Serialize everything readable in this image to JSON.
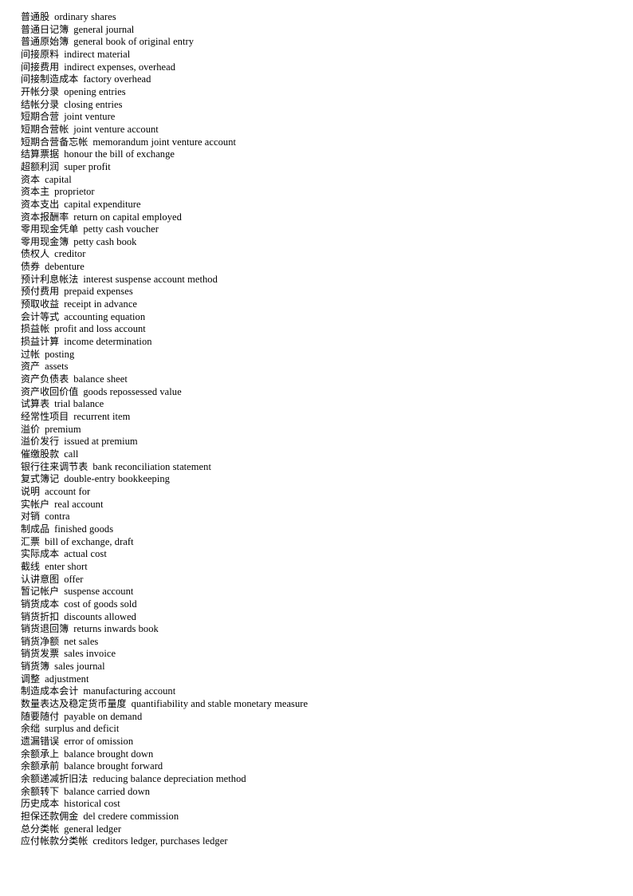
{
  "document": {
    "type": "glossary",
    "language_pair": "Chinese-English",
    "subject": "accounting terminology",
    "entries": [
      {
        "term": "普通股",
        "definition": "ordinary shares"
      },
      {
        "term": "普通日记簿",
        "definition": "general journal"
      },
      {
        "term": "普通原始簿",
        "definition": "general book of original entry"
      },
      {
        "term": "间接原料",
        "definition": "indirect material"
      },
      {
        "term": "间接费用",
        "definition": "indirect expenses, overhead"
      },
      {
        "term": "间接制造成本",
        "definition": "factory overhead"
      },
      {
        "term": "开帐分录",
        "definition": "opening entries"
      },
      {
        "term": "结帐分录",
        "definition": "closing entries"
      },
      {
        "term": "短期合营",
        "definition": "joint venture"
      },
      {
        "term": "短期合营帐",
        "definition": "joint venture account"
      },
      {
        "term": "短期合营备忘帐",
        "definition": "memorandum joint venture account"
      },
      {
        "term": "结算票据",
        "definition": "honour the bill of exchange"
      },
      {
        "term": "超额利润",
        "definition": "super profit"
      },
      {
        "term": "资本",
        "definition": "capital"
      },
      {
        "term": "资本主",
        "definition": "proprietor"
      },
      {
        "term": "资本支出",
        "definition": "capital expenditure"
      },
      {
        "term": "资本报酬率",
        "definition": "return on capital employed"
      },
      {
        "term": "零用现金凭单",
        "definition": "petty cash voucher"
      },
      {
        "term": "零用现金簿",
        "definition": "petty cash book"
      },
      {
        "term": "债权人",
        "definition": "creditor"
      },
      {
        "term": "债券",
        "definition": "debenture"
      },
      {
        "term": "预计利息帐法",
        "definition": "interest suspense account method"
      },
      {
        "term": "预付费用",
        "definition": "prepaid expenses"
      },
      {
        "term": "预取收益",
        "definition": "receipt in advance"
      },
      {
        "term": "会计等式",
        "definition": "accounting equation"
      },
      {
        "term": "损益帐",
        "definition": "profit and loss account"
      },
      {
        "term": "损益计算",
        "definition": "income determination"
      },
      {
        "term": "过帐",
        "definition": "posting"
      },
      {
        "term": "资产",
        "definition": "assets"
      },
      {
        "term": "资产负债表",
        "definition": "balance sheet"
      },
      {
        "term": "资产收回价值",
        "definition": "goods repossessed value"
      },
      {
        "term": "试算表",
        "definition": "trial balance"
      },
      {
        "term": "经常性项目",
        "definition": "recurrent item"
      },
      {
        "term": "溢价",
        "definition": "premium"
      },
      {
        "term": "溢价发行",
        "definition": "issued at premium"
      },
      {
        "term": "催缴股款",
        "definition": "call"
      },
      {
        "term": "银行往来调节表",
        "definition": "bank reconciliation statement"
      },
      {
        "term": "复式簿记",
        "definition": "double-entry bookkeeping"
      },
      {
        "term": "说明",
        "definition": "account for"
      },
      {
        "term": "实帐户",
        "definition": "real account"
      },
      {
        "term": "对销",
        "definition": "contra"
      },
      {
        "term": "制成品",
        "definition": "finished goods"
      },
      {
        "term": "汇票",
        "definition": "bill of exchange, draft"
      },
      {
        "term": "实际成本",
        "definition": "actual cost"
      },
      {
        "term": "截线",
        "definition": "enter short"
      },
      {
        "term": "认讲意图",
        "definition": "offer"
      },
      {
        "term": "暂记帐户",
        "definition": "suspense account"
      },
      {
        "term": "销货成本",
        "definition": "cost of goods sold"
      },
      {
        "term": "销货折扣",
        "definition": "discounts allowed"
      },
      {
        "term": "销货退回簿",
        "definition": "returns inwards book"
      },
      {
        "term": "销货净额",
        "definition": "net sales"
      },
      {
        "term": "销货发票",
        "definition": "sales invoice"
      },
      {
        "term": "销货簿",
        "definition": "sales journal"
      },
      {
        "term": "调整",
        "definition": "adjustment"
      },
      {
        "term": "制造成本会计",
        "definition": "manufacturing account"
      },
      {
        "term": "数量表达及稳定货币量度",
        "definition": "quantifiability and stable monetary measure"
      },
      {
        "term": "随要随付",
        "definition": "payable on demand"
      },
      {
        "term": "余绌",
        "definition": "surplus and deficit"
      },
      {
        "term": "遗漏错误",
        "definition": "error of omission"
      },
      {
        "term": "余额承上",
        "definition": "balance brought down"
      },
      {
        "term": "余额承前",
        "definition": "balance brought forward"
      },
      {
        "term": "余额递减折旧法",
        "definition": "reducing balance depreciation method"
      },
      {
        "term": "余额转下",
        "definition": "balance carried down"
      },
      {
        "term": "历史成本",
        "definition": "historical cost"
      },
      {
        "term": "担保还款佣金",
        "definition": "del credere commission"
      },
      {
        "term": "总分类帐",
        "definition": "general ledger"
      },
      {
        "term": "应付帐款分类帐",
        "definition": "creditors ledger, purchases ledger"
      }
    ]
  }
}
